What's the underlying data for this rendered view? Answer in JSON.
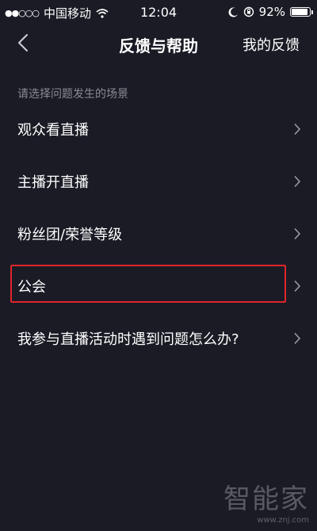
{
  "status_bar": {
    "signal_dots": "●●○○○",
    "carrier": "中国移动",
    "time": "12:04",
    "battery_text": "92%",
    "battery_level": 0.92
  },
  "nav": {
    "title": "反馈与帮助",
    "right_link": "我的反馈"
  },
  "section": {
    "header": "请选择问题发生的场景"
  },
  "items": [
    {
      "label": "观众看直播"
    },
    {
      "label": "主播开直播"
    },
    {
      "label": "粉丝团/荣誉等级"
    },
    {
      "label": "公会"
    },
    {
      "label": "我参与直播活动时遇到问题怎么办?"
    }
  ],
  "watermark": {
    "text": "智能家",
    "url": "www.znj.com"
  },
  "colors": {
    "background": "#1a1b25",
    "highlight": "#e0252b",
    "secondary_text": "#8a8b93"
  }
}
